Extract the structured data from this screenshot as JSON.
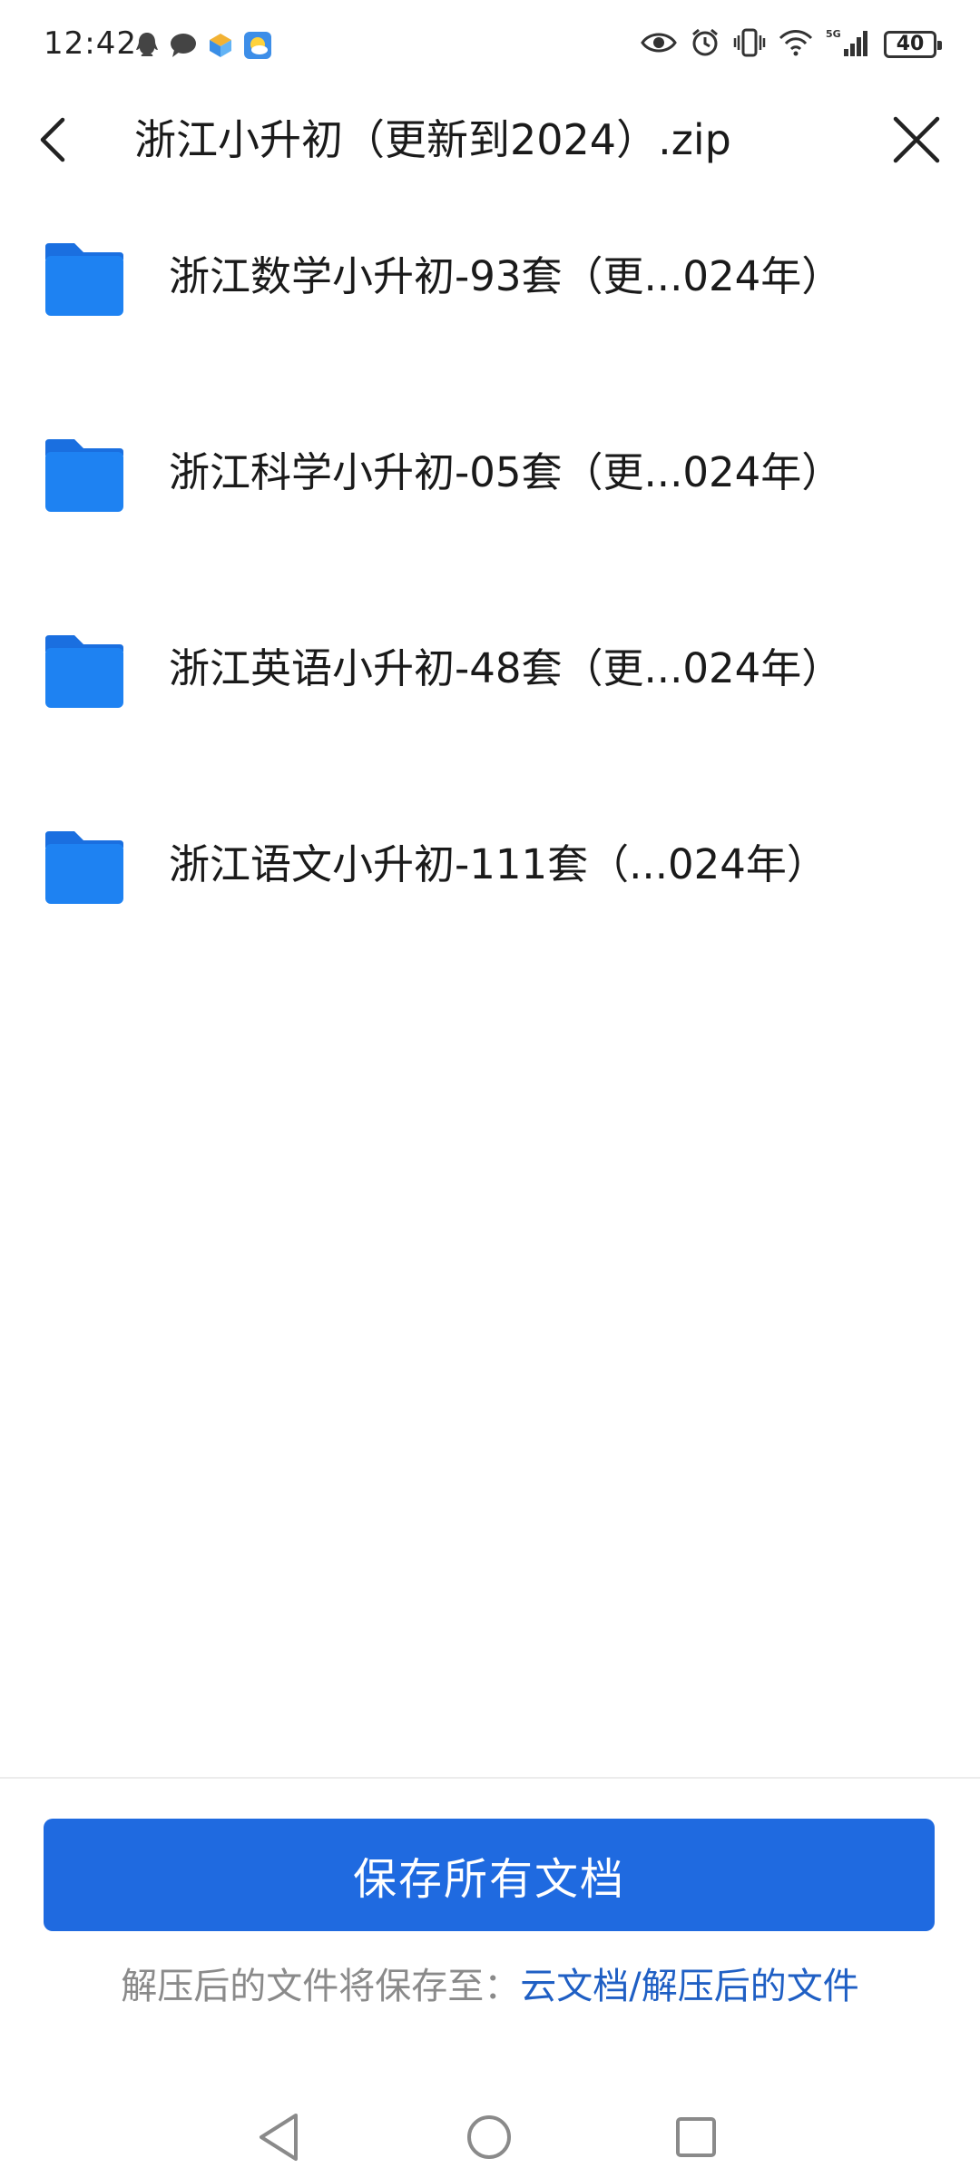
{
  "status_bar": {
    "time": "12:42",
    "battery": "40",
    "left_icons": [
      "qq-icon",
      "message-icon",
      "app-icon",
      "weather-icon"
    ],
    "right_icons": [
      "eye-icon",
      "alarm-icon",
      "vibrate-icon",
      "wifi-icon",
      "signal-5g-icon",
      "battery-icon"
    ]
  },
  "header": {
    "title": "浙江小升初（更新到2024）.zip"
  },
  "files": [
    {
      "name": "浙江数学小升初-93套（更...024年）",
      "icon": "folder-icon"
    },
    {
      "name": "浙江科学小升初-05套（更...024年）",
      "icon": "folder-icon"
    },
    {
      "name": "浙江英语小升初-48套（更...024年）",
      "icon": "folder-icon"
    },
    {
      "name": "浙江语文小升初-111套（...024年）",
      "icon": "folder-icon"
    }
  ],
  "footer": {
    "save_all_label": "保存所有文档",
    "save_to_label": "解压后的文件将保存至：",
    "save_to_path": "云文档/解压后的文件"
  },
  "colors": {
    "accent": "#1f6ae0",
    "folder": "#1e7ff0",
    "link": "#1f5fc4"
  }
}
